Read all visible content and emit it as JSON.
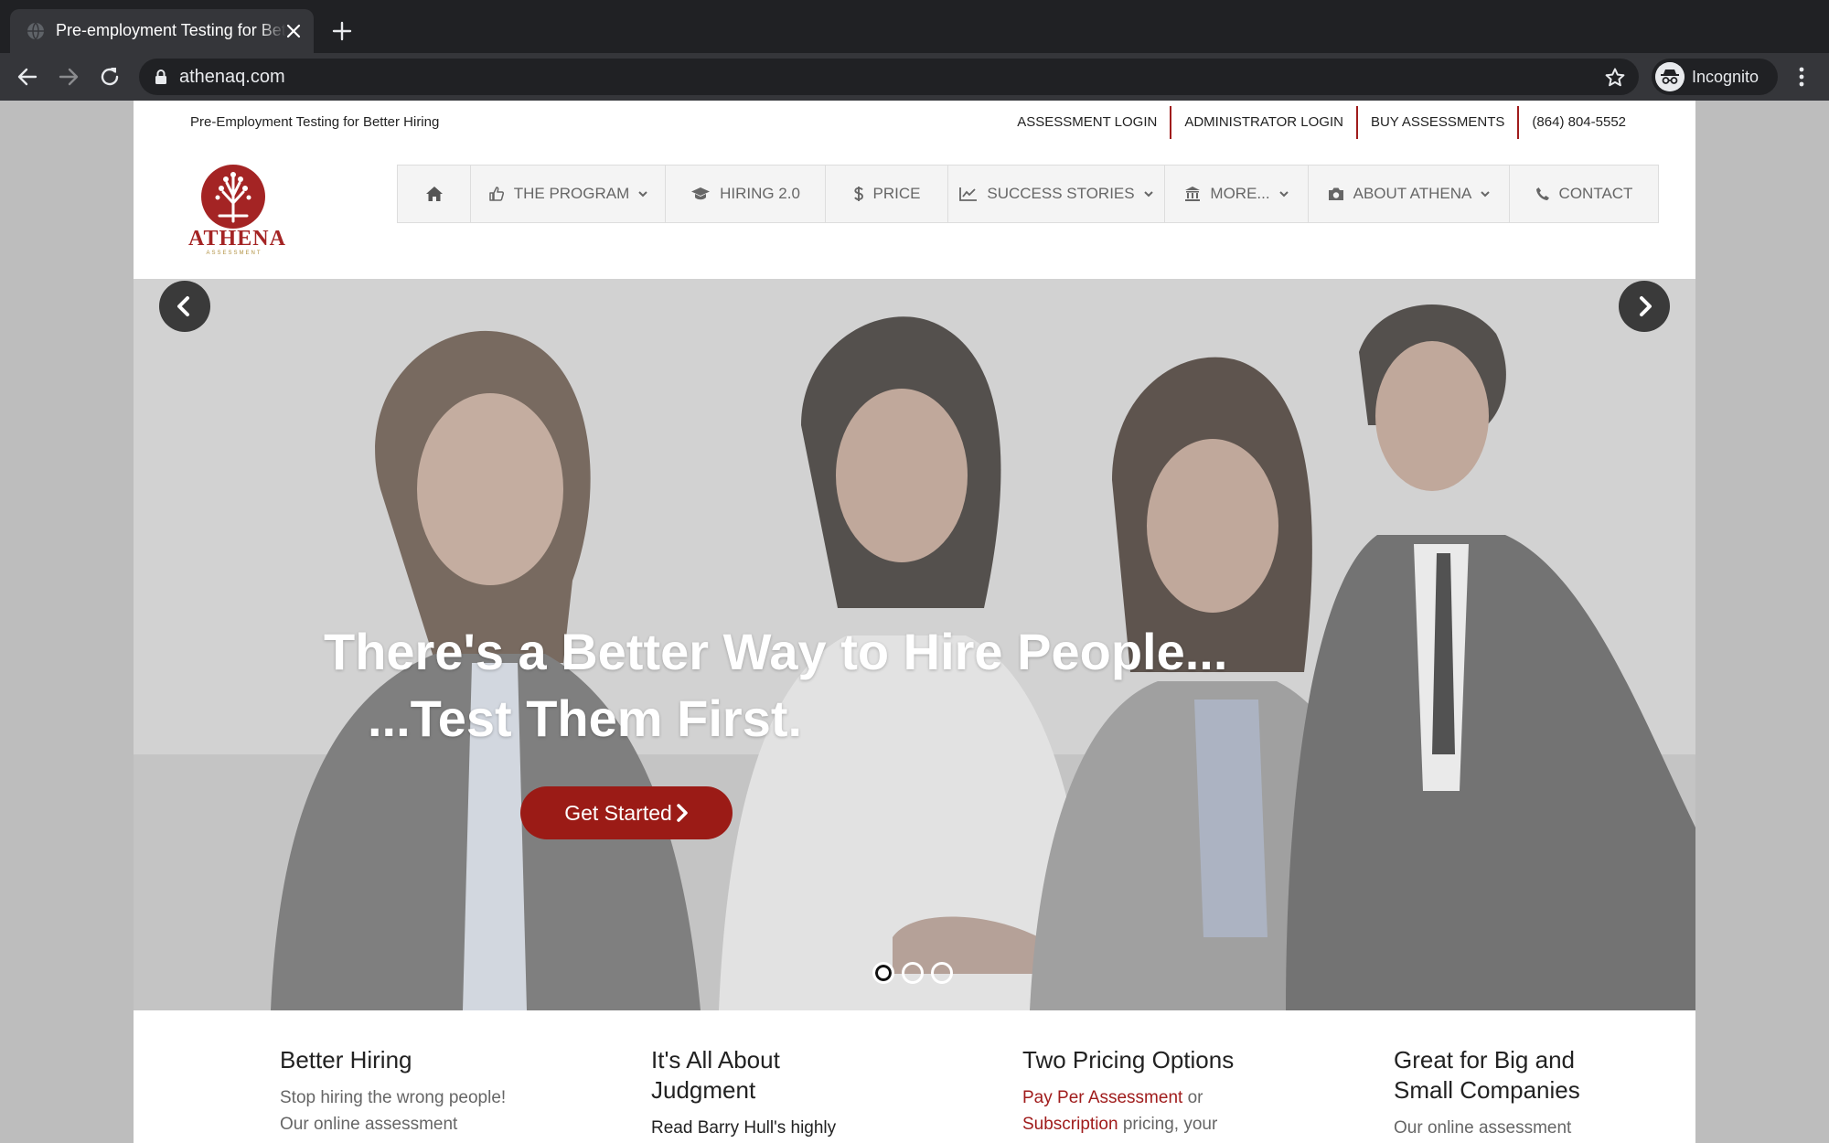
{
  "browser": {
    "tab_title": "Pre-employment Testing for Better Hiring",
    "url": "athenaq.com",
    "profile_label": "Incognito"
  },
  "site": {
    "tagline": "Pre-Employment Testing for Better Hiring",
    "top_links": [
      "ASSESSMENT LOGIN",
      "ADMINISTRATOR LOGIN",
      "BUY ASSESSMENTS",
      "(864) 804-5552"
    ],
    "logo": {
      "name": "ATHENA",
      "sub": "ASSESSMENT"
    },
    "nav": [
      {
        "label": "",
        "icon": "home-icon"
      },
      {
        "label": "THE PROGRAM",
        "icon": "thumbs-up-icon",
        "dropdown": true
      },
      {
        "label": "HIRING 2.0",
        "icon": "graduation-cap-icon",
        "dropdown": false
      },
      {
        "label": "PRICE",
        "icon": "dollar-icon",
        "dropdown": false
      },
      {
        "label": "SUCCESS STORIES",
        "icon": "line-chart-icon",
        "dropdown": true
      },
      {
        "label": "MORE...",
        "icon": "bank-icon",
        "dropdown": true
      },
      {
        "label": "ABOUT ATHENA",
        "icon": "camera-icon",
        "dropdown": true
      },
      {
        "label": "CONTACT",
        "icon": "phone-icon",
        "dropdown": false
      }
    ],
    "hero": {
      "line1": "There's a Better Way to Hire People...",
      "line2": "...Test Them First.",
      "cta": "Get Started",
      "slide_count": 3,
      "active_slide": 1
    },
    "features": [
      {
        "title": "Better Hiring",
        "text": [
          "Stop hiring the wrong people!",
          "Our online assessment"
        ]
      },
      {
        "title": "It's All About Judgment",
        "text": [
          "Read Barry Hull's highly"
        ]
      },
      {
        "title": "Two Pricing Options",
        "link1": "Pay Per Assessment",
        "text1": " or",
        "link2": "Subscription",
        "text2": " pricing, your"
      },
      {
        "title": "Great for Big and Small Companies",
        "text": [
          "Our online assessment"
        ]
      }
    ]
  },
  "colors": {
    "brand_red": "#9b1b16",
    "chrome_dark": "#202124",
    "chrome_toolbar": "#35363a"
  }
}
